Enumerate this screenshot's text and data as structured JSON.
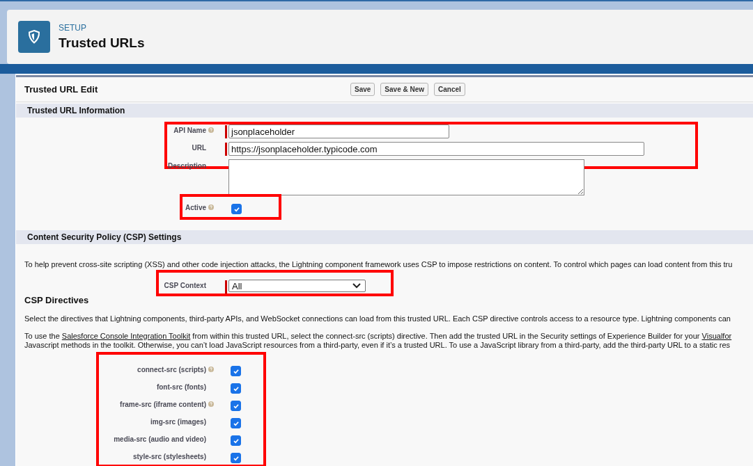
{
  "header": {
    "breadcrumb": "SETUP",
    "title": "Trusted URLs"
  },
  "edit_block": {
    "title": "Trusted URL Edit",
    "buttons": [
      "Save",
      "Save & New",
      "Cancel"
    ]
  },
  "info_section": {
    "title": "Trusted URL Information",
    "groups": [
      {
        "highlighted": true,
        "fields": [
          {
            "kind": "name",
            "label": "API Name",
            "help": true,
            "required": true,
            "value": "jsonplaceholder"
          },
          {
            "kind": "url",
            "label": "URL",
            "help": false,
            "required": true,
            "value": "https://jsonplaceholder.typicode.com"
          }
        ]
      },
      {
        "highlighted": false,
        "fields": [
          {
            "kind": "textarea",
            "label": "Description",
            "help": false,
            "required": false
          }
        ]
      },
      {
        "highlighted": true,
        "fields": [
          {
            "kind": "checkbox",
            "label": "Active",
            "help": true,
            "checked": true
          }
        ]
      }
    ]
  },
  "csp_section": {
    "title": "Content Security Policy (CSP) Settings",
    "intro": "To help prevent cross-site scripting (XSS) and other code injection attacks, the Lightning component framework uses CSP to impose restrictions on content. To control which pages can load content from this tru",
    "context": {
      "label": "CSP Context",
      "value": "All",
      "required": true,
      "highlighted": true
    },
    "directives_title": "CSP Directives",
    "paragraph": "Select the directives that Lightning components, third-party APIs, and WebSocket connections can load from this trusted URL. Each CSP directive controls access to a resource type. Lightning components can",
    "toolkit_lines": [
      [
        {
          "text": "To use the ",
          "link": false
        },
        {
          "text": "Salesforce Console Integration Toolkit",
          "link": true
        },
        {
          "text": " from within this trusted URL, select the connect-src (scripts) directive. Then add the trusted URL in the Security settings of Experience Builder for your ",
          "link": false
        },
        {
          "text": "Visualfor",
          "link": true
        }
      ],
      [
        {
          "text": "Javascript methods in the toolkit. Otherwise, you can’t load JavaScript resources from a third-party, even if it’s a trusted URL. To use a JavaScript library from a third-party, add the third-party URL to a static res",
          "link": false
        }
      ]
    ],
    "directives_highlighted": true,
    "directives": [
      {
        "label": "connect-src (scripts)",
        "help": true,
        "checked": true
      },
      {
        "label": "font-src (fonts)",
        "help": false,
        "checked": true
      },
      {
        "label": "frame-src (iframe content)",
        "help": true,
        "checked": true
      },
      {
        "label": "img-src (images)",
        "help": false,
        "checked": true
      },
      {
        "label": "media-src (audio and video)",
        "help": false,
        "checked": true
      },
      {
        "label": "style-src (stylesheets)",
        "help": false,
        "checked": true
      }
    ]
  }
}
